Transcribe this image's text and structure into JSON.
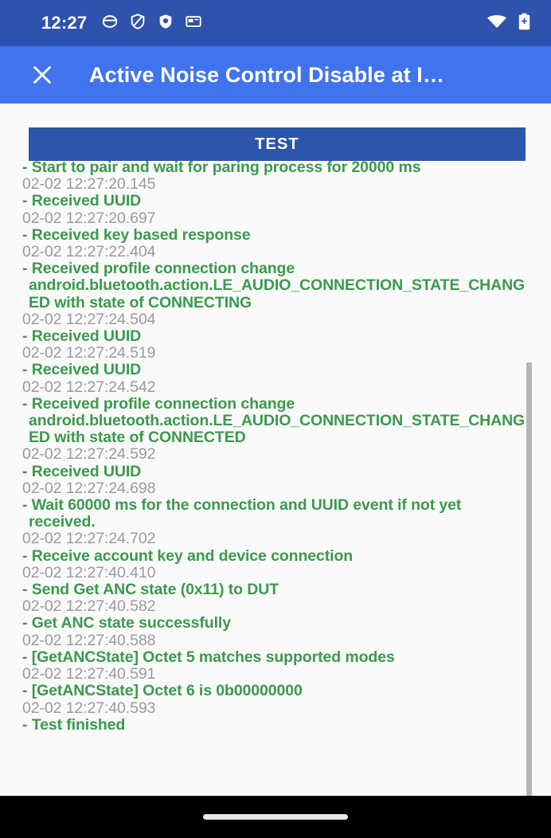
{
  "status_bar": {
    "clock": "12:27",
    "left_icons": [
      "notification-circle-icon",
      "notification-shield-slash-icon",
      "notification-shield-icon",
      "notification-card-icon"
    ],
    "right_icons": [
      "wifi-icon",
      "battery-icon"
    ],
    "background_color": "#2e53ad"
  },
  "app_bar": {
    "close_label": "✕",
    "title": "Active Noise Control Disable at I…",
    "background_color": "#4174ec"
  },
  "toolbar": {
    "test_label": "TEST",
    "test_color": "#2d55ab"
  },
  "colors": {
    "log_message": "#3a9a4c",
    "log_timestamp": "#9b9b9b",
    "page_background": "#fafafa",
    "scrollbar": "#b5b5b5"
  },
  "log": {
    "lines": [
      {
        "type": "msg",
        "text": "- Start to pair and wait for paring process for 20000 ms"
      },
      {
        "type": "ts",
        "text": "02-02 12:27:20.145"
      },
      {
        "type": "msg",
        "text": "- Received UUID"
      },
      {
        "type": "ts",
        "text": "02-02 12:27:20.697"
      },
      {
        "type": "msg",
        "text": "- Received key based response"
      },
      {
        "type": "ts",
        "text": "02-02 12:27:22.404"
      },
      {
        "type": "msg",
        "text": "- Received profile connection change android.bluetooth.action.LE_AUDIO_CONNECTION_STATE_CHANGED with state of CONNECTING"
      },
      {
        "type": "ts",
        "text": "02-02 12:27:24.504"
      },
      {
        "type": "msg",
        "text": "- Received UUID"
      },
      {
        "type": "ts",
        "text": "02-02 12:27:24.519"
      },
      {
        "type": "msg",
        "text": "- Received UUID"
      },
      {
        "type": "ts",
        "text": "02-02 12:27:24.542"
      },
      {
        "type": "msg",
        "text": "- Received profile connection change android.bluetooth.action.LE_AUDIO_CONNECTION_STATE_CHANGED with state of CONNECTED"
      },
      {
        "type": "ts",
        "text": "02-02 12:27:24.592"
      },
      {
        "type": "msg",
        "text": "- Received UUID"
      },
      {
        "type": "ts",
        "text": "02-02 12:27:24.698"
      },
      {
        "type": "msg",
        "text": "- Wait 60000 ms for the connection and UUID event if not yet received."
      },
      {
        "type": "ts",
        "text": "02-02 12:27:24.702"
      },
      {
        "type": "msg",
        "text": "- Receive account key and device connection"
      },
      {
        "type": "ts",
        "text": "02-02 12:27:40.410"
      },
      {
        "type": "msg",
        "text": "- Send Get ANC state (0x11) to DUT"
      },
      {
        "type": "ts",
        "text": "02-02 12:27:40.582"
      },
      {
        "type": "msg",
        "text": "- Get ANC state successfully"
      },
      {
        "type": "ts",
        "text": "02-02 12:27:40.588"
      },
      {
        "type": "msg",
        "text": "- [GetANCState] Octet 5 matches supported modes"
      },
      {
        "type": "ts",
        "text": "02-02 12:27:40.591"
      },
      {
        "type": "msg",
        "text": "- [GetANCState] Octet 6 is 0b00000000"
      },
      {
        "type": "ts",
        "text": "02-02 12:27:40.593"
      },
      {
        "type": "msg",
        "text": "- Test finished"
      }
    ]
  },
  "nav_bar": {
    "home_indicator": "home-indicator"
  }
}
